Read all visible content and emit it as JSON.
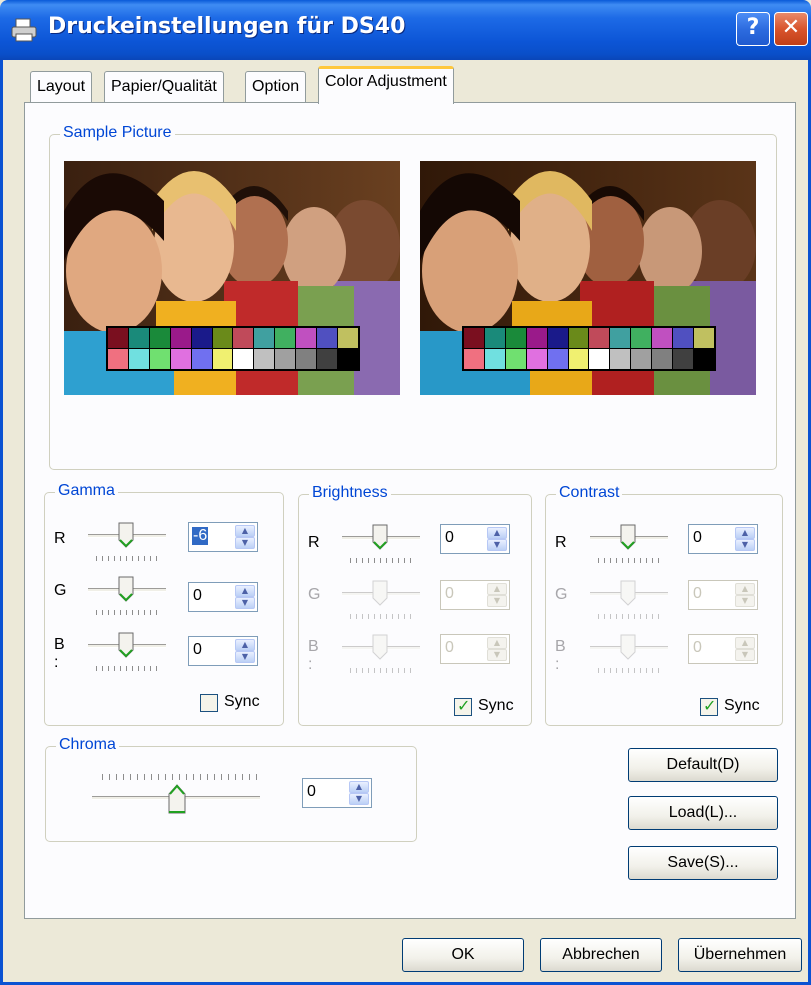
{
  "window": {
    "title": "Druckeinstellungen für DS40",
    "help_glyph": "?",
    "close_glyph": "✕"
  },
  "tabs": [
    {
      "label": "Layout"
    },
    {
      "label": "Papier/Qualität"
    },
    {
      "label": "Option"
    },
    {
      "label": "Color Adjustment",
      "active": true
    }
  ],
  "sample": {
    "label": "Sample Picture",
    "swatch_row1": [
      "#7a0f1f",
      "#1a8a7a",
      "#1a8a3a",
      "#9a1a8a",
      "#1a1a8a",
      "#6a8a1a",
      "#c04a5a",
      "#40a0a0",
      "#40b060",
      "#c050c0",
      "#5050c0",
      "#c0c060"
    ],
    "swatch_row2": [
      "#f07080",
      "#70e0e0",
      "#70e070",
      "#e070e0",
      "#7070f0",
      "#f0f070",
      "#ffffff",
      "#c0c0c0",
      "#a0a0a0",
      "#808080",
      "#404040",
      "#000000"
    ]
  },
  "gamma": {
    "label": "Gamma",
    "rows": [
      {
        "channel": "R",
        "value": "-6"
      },
      {
        "channel": "G",
        "value": "0"
      },
      {
        "channel": "B :",
        "value": "0"
      }
    ],
    "sync_label": "Sync",
    "sync_checked": false
  },
  "brightness": {
    "label": "Brightness",
    "rows": [
      {
        "channel": "R",
        "value": "0"
      },
      {
        "channel": "G",
        "value": "0"
      },
      {
        "channel": "B :",
        "value": "0"
      }
    ],
    "sync_label": "Sync",
    "sync_checked": true
  },
  "contrast": {
    "label": "Contrast",
    "rows": [
      {
        "channel": "R",
        "value": "0"
      },
      {
        "channel": "G",
        "value": "0"
      },
      {
        "channel": "B :",
        "value": "0"
      }
    ],
    "sync_label": "Sync",
    "sync_checked": true
  },
  "chroma": {
    "label": "Chroma",
    "value": "0"
  },
  "side_buttons": {
    "default": "Default(D)",
    "load": "Load(L)...",
    "save": "Save(S)..."
  },
  "footer": {
    "ok": "OK",
    "cancel": "Abbrechen",
    "apply": "Übernehmen"
  }
}
